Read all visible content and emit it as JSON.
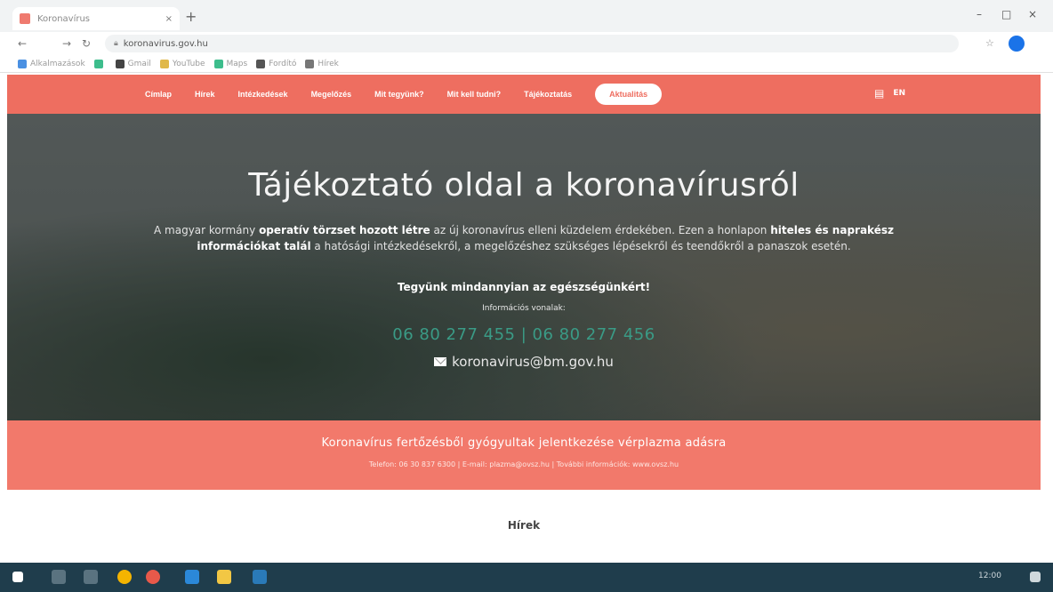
{
  "browser": {
    "tab_title": "Koronavírus",
    "tab_close": "×",
    "new_tab": "+",
    "url": "koronavirus.gov.hu",
    "window_controls": [
      "–",
      "□",
      "×"
    ],
    "bookmarks": [
      {
        "label": "Alkalmazások",
        "color": "#4a90e2"
      },
      {
        "label": "",
        "color": "#3dbd8c"
      },
      {
        "label": "Gmail",
        "color": "#444444"
      },
      {
        "label": "YouTube",
        "color": "#e0b84a"
      },
      {
        "label": "Maps",
        "color": "#3dbd8c"
      },
      {
        "label": "Fordító",
        "color": "#555555"
      },
      {
        "label": "Hírek",
        "color": "#777777"
      }
    ]
  },
  "site": {
    "nav": [
      {
        "label": "Címlap",
        "active": false
      },
      {
        "label": "Hírek",
        "active": false
      },
      {
        "label": "Intézkedések",
        "active": false
      },
      {
        "label": "Megelőzés",
        "active": false
      },
      {
        "label": "Mit tegyünk?",
        "active": false
      },
      {
        "label": "Mit kell tudni?",
        "active": false
      },
      {
        "label": "Tájékoztatás",
        "active": false
      },
      {
        "label": "Aktualitás",
        "active": true
      }
    ],
    "lang": "EN",
    "hero": {
      "title": "Tájékoztató oldal a koronavírusról",
      "desc_1": "A magyar kormány ",
      "desc_b1": "operatív törzset hozott létre",
      "desc_2": " az új koronavírus elleni küzdelem érdekében. Ezen a honlapon ",
      "desc_b2": "hiteles és naprakész információkat talál",
      "desc_3": " a hatósági intézkedésekről, a megelőzéshez szükséges lépésekről és teendőkről a panaszok esetén.",
      "cta": "Tegyünk mindannyian az egészségünkért!",
      "info_label": "Információs vonalak:",
      "phone": "06 80 277 455 | 06 80 277 456",
      "email": "koronavirus@bm.gov.hu"
    },
    "banner": {
      "title": "Koronavírus fertőzésből gyógyultak jelentkezése vérplazma adásra",
      "sub": "Telefon: 06 30 837 6300 | E-mail: plazma@ovsz.hu | További információk: www.ovsz.hu"
    },
    "section_heading": "Hírek"
  },
  "taskbar": {
    "clock": "12:00"
  }
}
